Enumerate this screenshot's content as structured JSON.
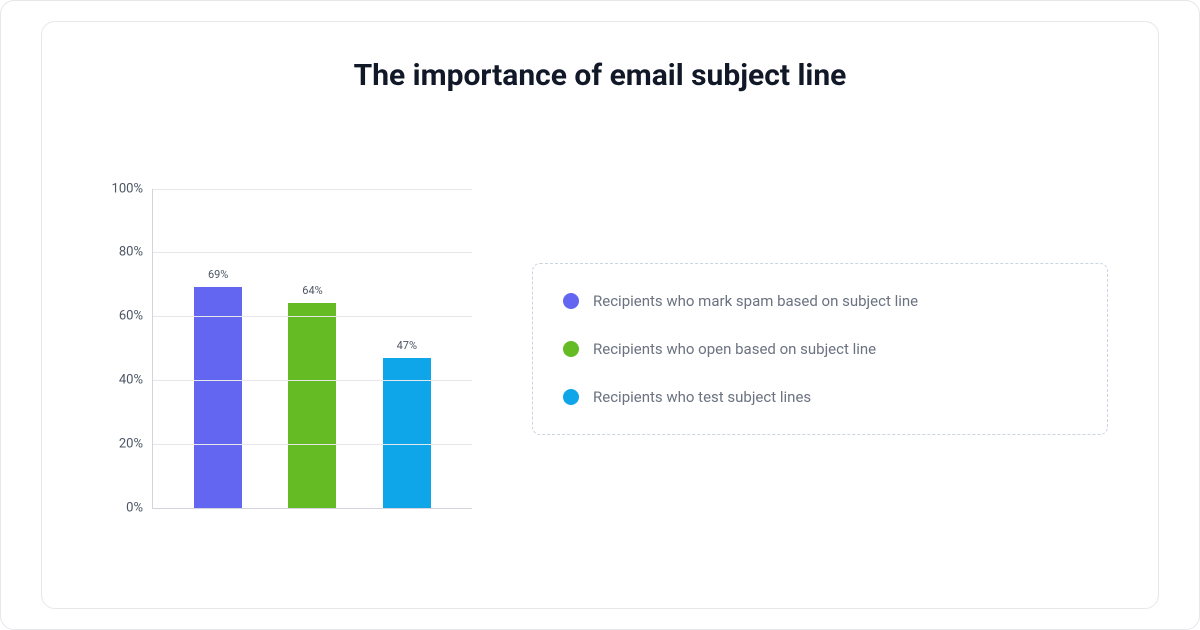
{
  "title": "The importance of email subject line",
  "chart_data": {
    "type": "bar",
    "categories": [
      "",
      "",
      ""
    ],
    "series": [
      {
        "name": "Recipients who mark spam based on subject line",
        "value": 69,
        "color": "#6366f1"
      },
      {
        "name": "Recipients who open based on subject line",
        "value": 64,
        "color": "#65bb24"
      },
      {
        "name": "Recipients who test subject lines",
        "value": 47,
        "color": "#0ea5e9"
      }
    ],
    "value_labels": [
      "69%",
      "64%",
      "47%"
    ],
    "ylim": [
      0,
      100
    ],
    "y_ticks": [
      0,
      20,
      40,
      60,
      80,
      100
    ],
    "y_tick_labels": [
      "0%",
      "20%",
      "40%",
      "60%",
      "80%",
      "100%"
    ],
    "title": "The importance of email subject line",
    "xlabel": "",
    "ylabel": ""
  },
  "legend": {
    "items": [
      {
        "label": "Recipients who mark spam based on subject line",
        "color": "#6366f1"
      },
      {
        "label": "Recipients who open based on subject line",
        "color": "#65bb24"
      },
      {
        "label": "Recipients who test subject lines",
        "color": "#0ea5e9"
      }
    ]
  }
}
